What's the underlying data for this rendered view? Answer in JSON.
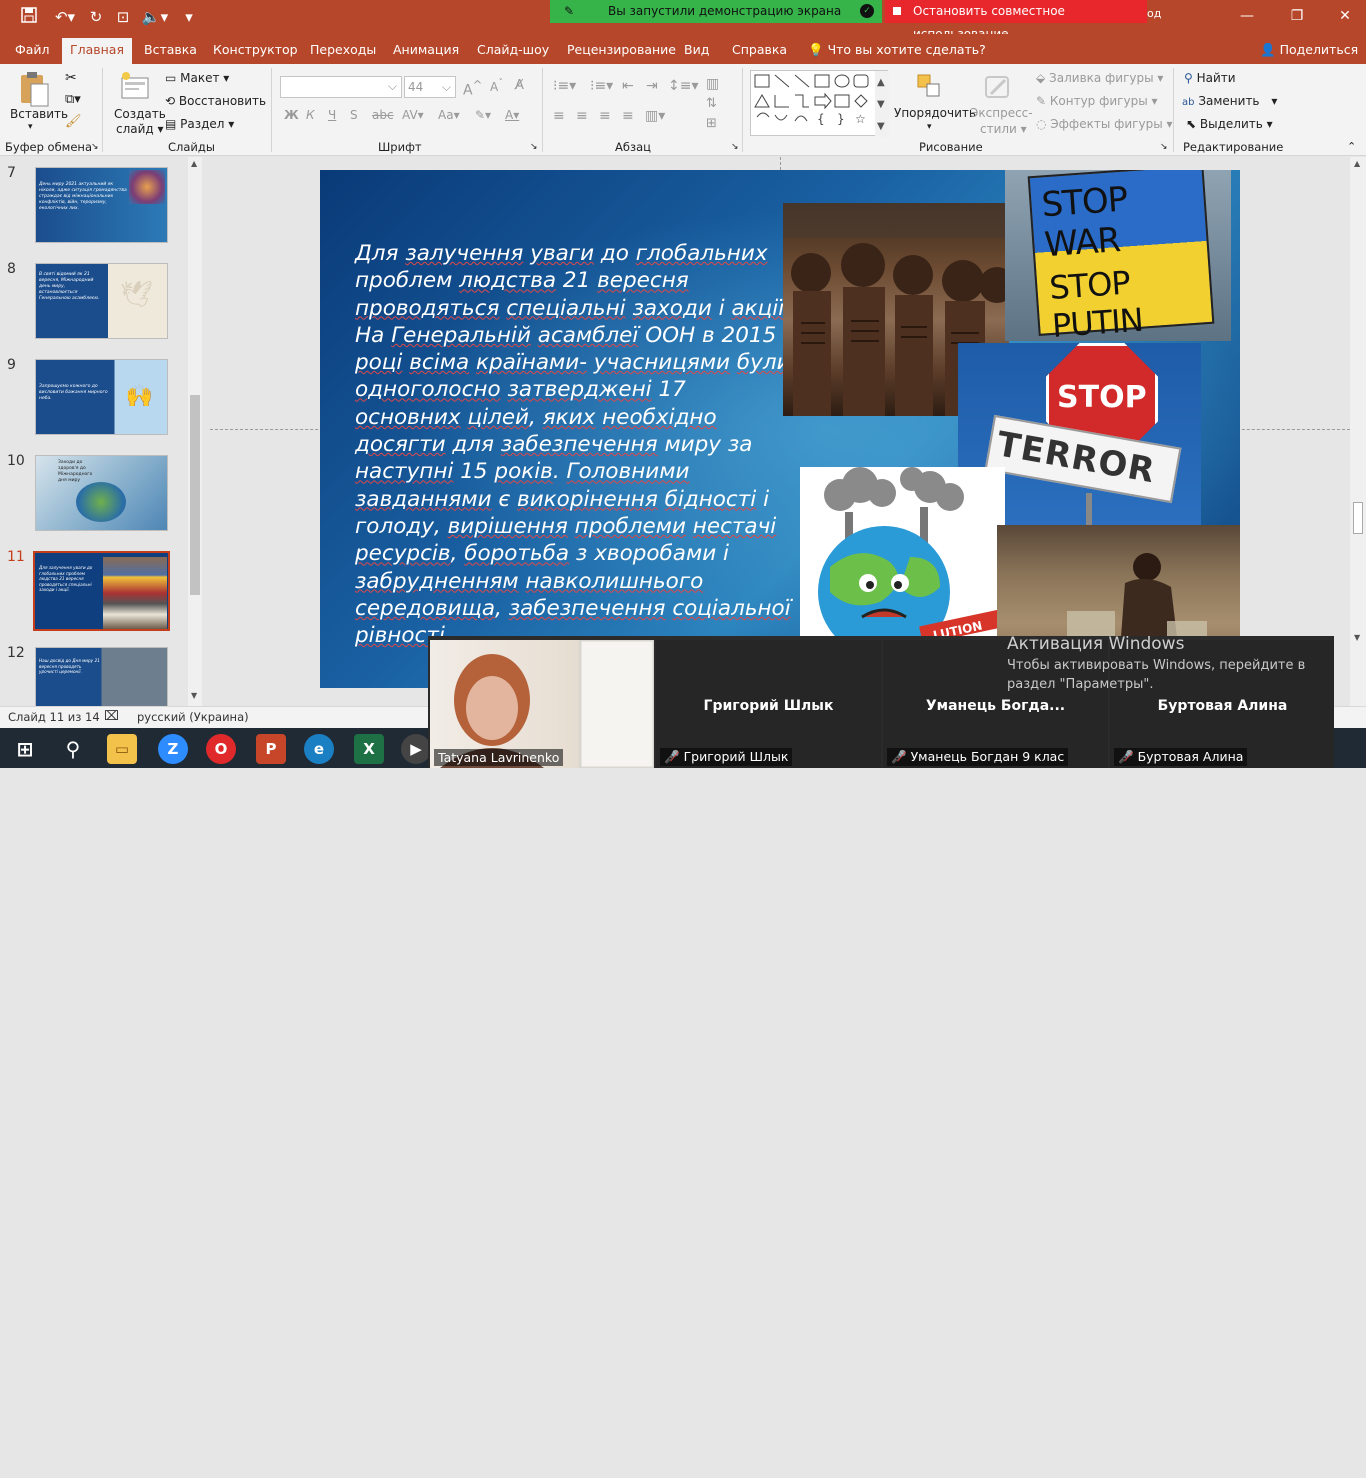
{
  "banners": {
    "share_status": "Вы запустили демонстрацию экрана",
    "stop_share": "Остановить совместное использование",
    "hidden_tail": "од"
  },
  "tabs": [
    "Файл",
    "Главная",
    "Вставка",
    "Конструктор",
    "Переходы",
    "Анимация",
    "Слайд-шоу",
    "Рецензирование",
    "Вид",
    "Справка"
  ],
  "tell_me": "Что вы хотите сделать?",
  "share_button": "Поделиться",
  "ribbon": {
    "paste": "Вставить",
    "clipboard_group": "Буфер обмена",
    "new_slide": "Создать",
    "new_slide2": "слайд",
    "layout": "Макет",
    "reset": "Восстановить",
    "section": "Раздел",
    "slides_group": "Слайды",
    "font_size": "44",
    "font_group": "Шрифт",
    "bold": "Ж",
    "italic": "К",
    "underline": "Ч",
    "strike": "S",
    "paragraph_group": "Абзац",
    "arrange": "Упорядочить",
    "quick_styles": "Экспресс-",
    "quick_styles2": "стили",
    "shape_fill": "Заливка фигуры",
    "shape_outline": "Контур фигуры",
    "shape_effects": "Эффекты фигуры",
    "drawing_group": "Рисование",
    "find": "Найти",
    "replace": "Заменить",
    "select": "Выделить",
    "editing_group": "Редактирование"
  },
  "thumbnails": [
    {
      "num": "7",
      "text": "День миру 2021 актуальний як ніколи, адже ситуація громадянства страждає від міжнаціональних конфліктів, війн, тероризму, екологічних лих."
    },
    {
      "num": "8",
      "text": "В святі відомий як 21 вересня, Міжнародний день миру, встановлюється Генеральною асамблеєю."
    },
    {
      "num": "9",
      "text": "Запрошуємо кожного до висловити бажання мирного неба."
    },
    {
      "num": "10",
      "text": "Заходи до здоров'я до Міжнародного дня миру"
    },
    {
      "num": "11",
      "text": "Для залучення уваги до глобальних проблем людства 21 вересня проводяться спеціальні заходи і акції."
    },
    {
      "num": "12",
      "text": "Наш досвід до Дня миру 21 вересня проводять урочисті церемонії."
    }
  ],
  "slide": {
    "text_segments": [
      {
        "t": "Для ",
        "u": false
      },
      {
        "t": "залучення",
        "u": true
      },
      {
        "t": " ",
        "u": false
      },
      {
        "t": "уваги",
        "u": true
      },
      {
        "t": " до ",
        "u": false
      },
      {
        "t": "глобальних",
        "u": true
      },
      {
        "t": " ",
        "u": false
      },
      {
        "t": "проблем",
        "u": false
      },
      {
        "t": " ",
        "u": false
      },
      {
        "t": "людства",
        "u": true
      },
      {
        "t": " 21 ",
        "u": false
      },
      {
        "t": "вересня",
        "u": true
      },
      {
        "t": " ",
        "u": false
      },
      {
        "t": "проводяться",
        "u": true
      },
      {
        "t": " ",
        "u": false
      },
      {
        "t": "спеціальні",
        "u": true
      },
      {
        "t": " ",
        "u": false
      },
      {
        "t": "заходи",
        "u": true
      },
      {
        "t": " і ",
        "u": false
      },
      {
        "t": "акції",
        "u": true
      },
      {
        "t": ". На ",
        "u": false
      },
      {
        "t": "Генеральній",
        "u": true
      },
      {
        "t": " ",
        "u": false
      },
      {
        "t": "асамблеї",
        "u": true
      },
      {
        "t": " ООН ",
        "u": false
      },
      {
        "t": "в 2015 ",
        "u": false
      },
      {
        "t": "році",
        "u": true
      },
      {
        "t": " ",
        "u": false
      },
      {
        "t": "всіма",
        "u": true
      },
      {
        "t": " ",
        "u": false
      },
      {
        "t": "країнами-",
        "u": true
      },
      {
        "t": " ",
        "u": false
      },
      {
        "t": "учасницями",
        "u": true
      },
      {
        "t": " ",
        "u": false
      },
      {
        "t": "були",
        "u": true
      },
      {
        "t": " ",
        "u": false
      },
      {
        "t": "одноголосно",
        "u": true
      },
      {
        "t": " ",
        "u": false
      },
      {
        "t": "затверджені",
        "u": true
      },
      {
        "t": " 17 ",
        "u": false
      },
      {
        "t": "основних",
        "u": true
      },
      {
        "t": " ",
        "u": false
      },
      {
        "t": "цілей",
        "u": true
      },
      {
        "t": ", ",
        "u": false
      },
      {
        "t": "яких",
        "u": true
      },
      {
        "t": " ",
        "u": false
      },
      {
        "t": "необхідно",
        "u": true
      },
      {
        "t": " ",
        "u": false
      },
      {
        "t": "досягти",
        "u": true
      },
      {
        "t": " для ",
        "u": false
      },
      {
        "t": "забезпечення",
        "u": true
      },
      {
        "t": " ",
        "u": false
      },
      {
        "t": "миру за ",
        "u": false
      },
      {
        "t": "наступні",
        "u": true
      },
      {
        "t": " 15 ",
        "u": false
      },
      {
        "t": "років",
        "u": true
      },
      {
        "t": ". ",
        "u": false
      },
      {
        "t": "Головними",
        "u": true
      },
      {
        "t": " ",
        "u": false
      },
      {
        "t": "завданнями",
        "u": true
      },
      {
        "t": " є ",
        "u": false
      },
      {
        "t": "викорінення",
        "u": true
      },
      {
        "t": " ",
        "u": false
      },
      {
        "t": "бідності",
        "u": true
      },
      {
        "t": " і ",
        "u": false
      },
      {
        "t": "голоду, ",
        "u": false
      },
      {
        "t": "вирішення",
        "u": true
      },
      {
        "t": " ",
        "u": false
      },
      {
        "t": "проблеми",
        "u": true
      },
      {
        "t": " ",
        "u": false
      },
      {
        "t": "нестачі",
        "u": true
      },
      {
        "t": " ",
        "u": false
      },
      {
        "t": "ресурсів",
        "u": true
      },
      {
        "t": ", ",
        "u": false
      },
      {
        "t": "боротьба",
        "u": true
      },
      {
        "t": " з ",
        "u": false
      },
      {
        "t": "хворобами",
        "u": false
      },
      {
        "t": " і ",
        "u": false
      },
      {
        "t": "забрудненням",
        "u": true
      },
      {
        "t": " ",
        "u": false
      },
      {
        "t": "навколишнього",
        "u": true
      },
      {
        "t": " ",
        "u": false
      },
      {
        "t": "середовища",
        "u": true
      },
      {
        "t": ", ",
        "u": false
      },
      {
        "t": "забезпечення",
        "u": true
      },
      {
        "t": " ",
        "u": false
      },
      {
        "t": "соціальної рівності",
        "u": true
      }
    ],
    "sign_stop_war": "STOP WAR",
    "sign_stop_putin": "STOP PUTIN",
    "sign_stop": "STOP",
    "sign_terror": "TERROR",
    "pollution_banner": "LUTION"
  },
  "statusbar": {
    "slide_counter": "Слайд 11 из 14",
    "language": "русский (Украина)"
  },
  "activation": {
    "title": "Активация Windows",
    "line1": "Чтобы активировать Windows, перейдите в",
    "line2": "раздел \"Параметры\"."
  },
  "video": {
    "self_name": "Tatyana Lavrinenko",
    "p1": "Григорий Шлык",
    "p1_label": "Григорий Шлык",
    "p2": "Уманець  Богда...",
    "p2_label": "Уманець Богдан 9 клас",
    "p3": "Буртовая Алина",
    "p3_label": "Буртовая Алина"
  },
  "colors": {
    "accent": "#b7472a",
    "share_green": "#36b44a",
    "stop_red": "#e8272d"
  }
}
